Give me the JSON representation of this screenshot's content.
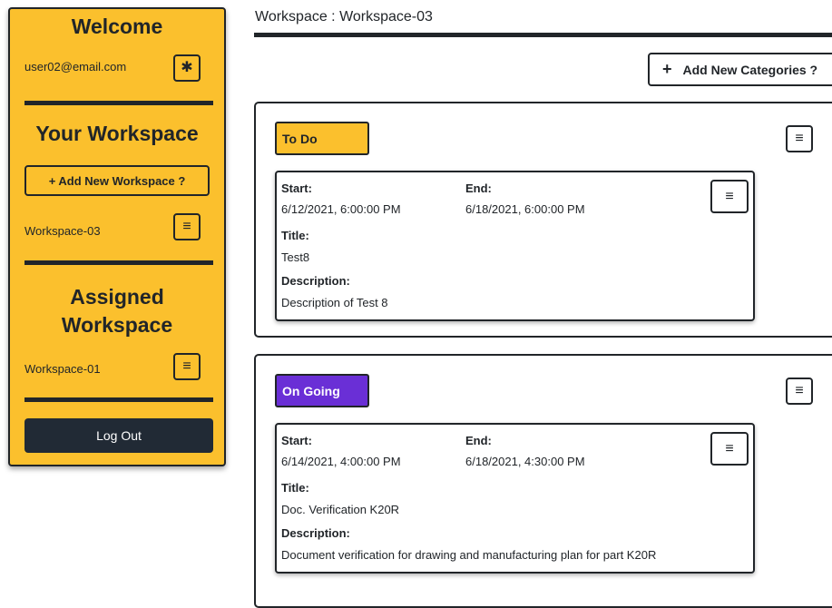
{
  "sidebar": {
    "welcome": "Welcome",
    "user_email": "user02@email.com",
    "your_workspace_title": "Your Workspace",
    "add_workspace_label": "+ Add New Workspace ?",
    "your_workspaces": [
      {
        "name": "Workspace-03"
      }
    ],
    "assigned_title_line1": "Assigned",
    "assigned_title_line2": "Workspace",
    "assigned_workspaces": [
      {
        "name": "Workspace-01"
      }
    ],
    "logout_label": "Log Out"
  },
  "main": {
    "header": "Workspace : Workspace-03",
    "add_category_label": "Add New Categories ?",
    "categories": [
      {
        "name": "To Do",
        "color": "#fbc02d",
        "text_color": "#212529",
        "task": {
          "start_label": "Start:",
          "start": "6/12/2021, 6:00:00 PM",
          "end_label": "End:",
          "end": "6/18/2021, 6:00:00 PM",
          "title_label": "Title:",
          "title": "Test8",
          "description_label": "Description:",
          "description": "Description of Test 8"
        }
      },
      {
        "name": "On Going",
        "color": "#6a2fd6",
        "text_color": "#ffffff",
        "task": {
          "start_label": "Start:",
          "start": "6/14/2021, 4:00:00 PM",
          "end_label": "End:",
          "end": "6/18/2021, 4:30:00 PM",
          "title_label": "Title:",
          "title": "Doc. Verification K20R",
          "description_label": "Description:",
          "description": "Document verification for drawing and manufacturing plan for part K20R"
        }
      }
    ]
  },
  "icons": {
    "settings": "gear-icon",
    "menu": "hamburger-icon",
    "add": "plus-icon"
  },
  "colors": {
    "sidebar_bg": "#fbc02d",
    "dark": "#212529",
    "logout_bg": "#212a35",
    "on_going": "#6a2fd6"
  }
}
